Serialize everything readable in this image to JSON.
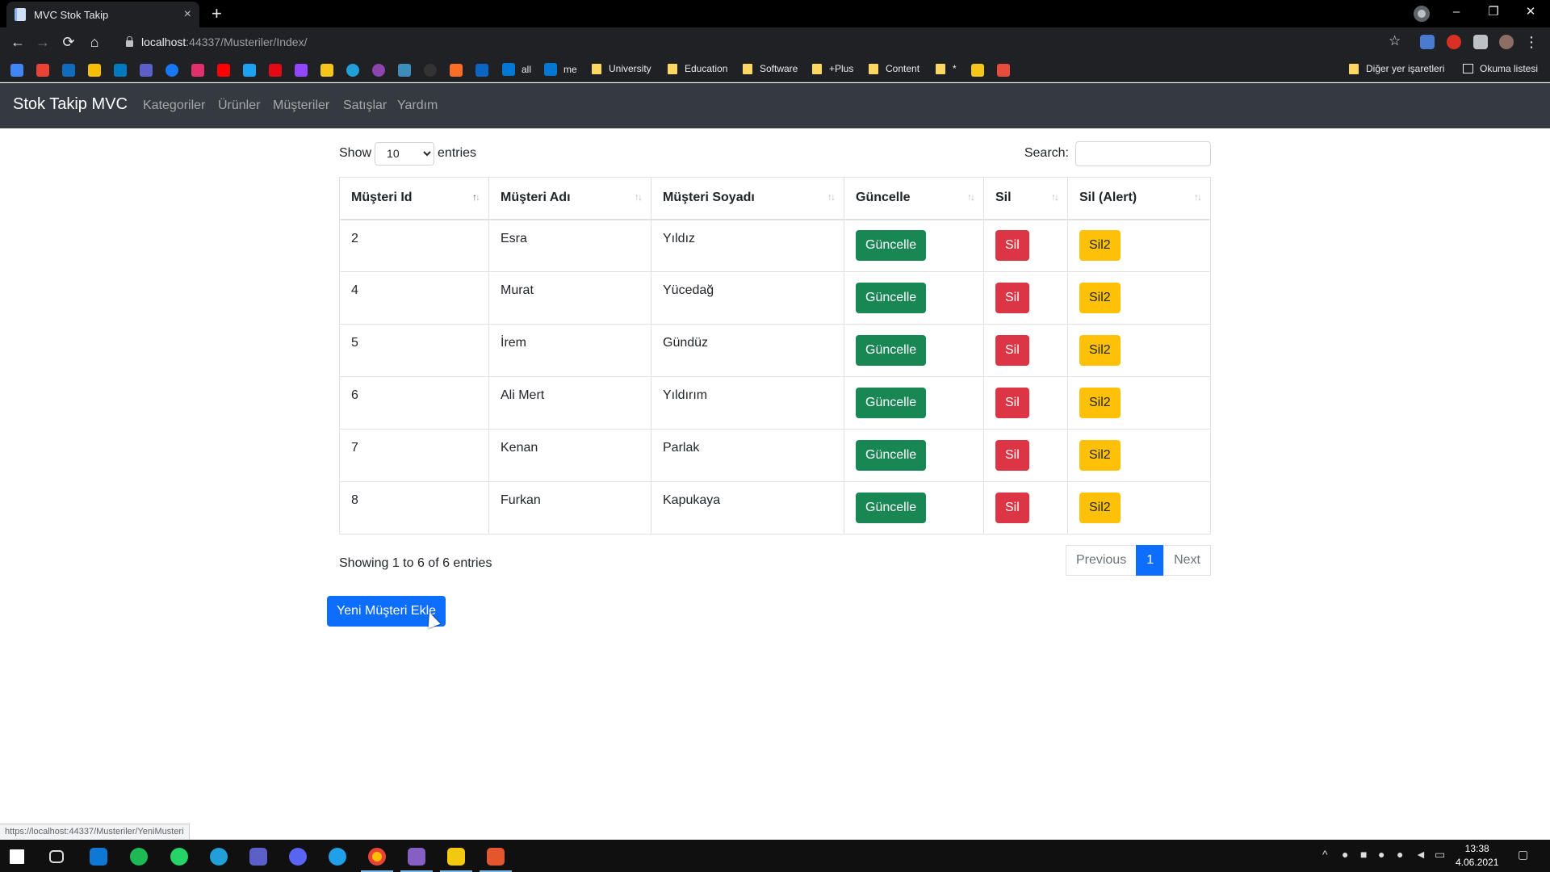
{
  "browser": {
    "tab_title": "MVC Stok Takip",
    "tab_close": "×",
    "new_tab": "+",
    "url_host": "localhost",
    "url_path": ":44337/Musteriler/Index/",
    "status_url": "https://localhost:44337/Musteriler/YeniMusteri",
    "window_controls": [
      "–",
      "❐",
      "✕"
    ],
    "bookmarks": [
      {
        "label": "all"
      },
      {
        "label": "me"
      },
      {
        "label": "University"
      },
      {
        "label": "Education"
      },
      {
        "label": "Software"
      },
      {
        "label": "+Plus"
      },
      {
        "label": "Content"
      },
      {
        "label": "*"
      }
    ],
    "other_bookmarks": "Diğer yer işaretleri",
    "reading_list": "Okuma listesi"
  },
  "navbar": {
    "brand": "Stok Takip MVC",
    "links": [
      "Kategoriler",
      "Ürünler",
      "Müşteriler",
      "Satışlar",
      "Yardım"
    ]
  },
  "datatable": {
    "show_label": "Show",
    "page_length": "10",
    "entries_label": "entries",
    "search_label": "Search:",
    "search_value": "",
    "columns": [
      "Müşteri Id",
      "Müşteri Adı",
      "Müşteri Soyadı",
      "Güncelle",
      "Sil",
      "Sil (Alert)"
    ],
    "rows": [
      {
        "id": "2",
        "ad": "Esra",
        "soyad": "Yıldız"
      },
      {
        "id": "4",
        "ad": "Murat",
        "soyad": "Yücedağ"
      },
      {
        "id": "5",
        "ad": "İrem",
        "soyad": "Gündüz"
      },
      {
        "id": "6",
        "ad": "Ali Mert",
        "soyad": "Yıldırım"
      },
      {
        "id": "7",
        "ad": "Kenan",
        "soyad": "Parlak"
      },
      {
        "id": "8",
        "ad": "Furkan",
        "soyad": "Kapukaya"
      }
    ],
    "update_label": "Güncelle",
    "delete_label": "Sil",
    "delete_alert_label": "Sil2",
    "info": "Showing 1 to 6 of 6 entries",
    "previous": "Previous",
    "current_page": "1",
    "next": "Next"
  },
  "add_button": "Yeni Müşteri Ekle",
  "taskbar": {
    "time": "13:38",
    "date": "4.06.2021"
  },
  "colors": {
    "success": "#198754",
    "danger": "#dc3545",
    "warning": "#ffc107",
    "primary": "#0d6efd",
    "navbar": "#343a40"
  }
}
